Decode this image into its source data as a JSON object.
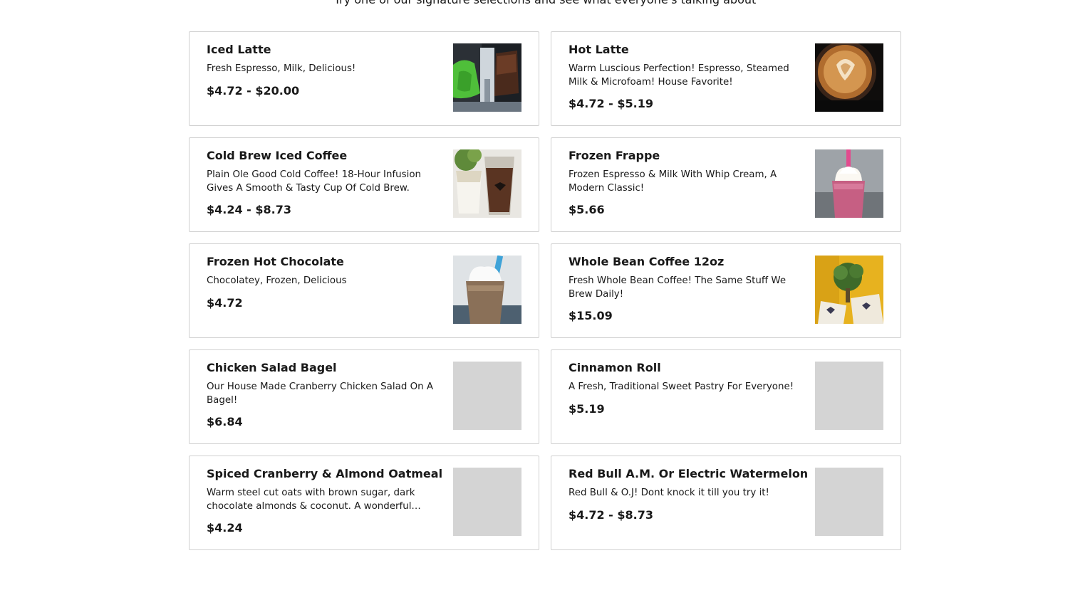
{
  "header": {
    "subtitle": "Try one of our signature selections and see what everyone's talking about"
  },
  "items": [
    {
      "name": "Iced Latte",
      "description": "Fresh Espresso, Milk, Delicious!",
      "price": "$4.72 - $20.00",
      "image": "iced-latte-photo"
    },
    {
      "name": "Hot Latte",
      "description": "Warm Luscious Perfection! Espresso, Steamed Milk & Microfoam! House Favorite!",
      "price": "$4.72 - $5.19",
      "image": "hot-latte-photo"
    },
    {
      "name": "Cold Brew Iced Coffee",
      "description": "Plain Ole Good Cold Coffee! 18-Hour Infusion Gives A Smooth & Tasty Cup Of Cold Brew.",
      "price": "$4.24 - $8.73",
      "image": "cold-brew-photo"
    },
    {
      "name": "Frozen Frappe",
      "description": "Frozen Espresso & Milk With Whip Cream, A Modern Classic!",
      "price": "$5.66",
      "image": "frozen-frappe-photo"
    },
    {
      "name": "Frozen Hot Chocolate",
      "description": "Chocolatey, Frozen, Delicious",
      "price": "$4.72",
      "image": "frozen-hot-chocolate-photo"
    },
    {
      "name": "Whole Bean Coffee 12oz",
      "description": "Fresh Whole Bean Coffee! The Same Stuff We Brew Daily!",
      "price": "$15.09",
      "image": "whole-bean-coffee-photo"
    },
    {
      "name": "Chicken Salad Bagel",
      "description": "Our House Made Cranberry Chicken Salad On A Bagel!",
      "price": "$6.84",
      "image": "placeholder"
    },
    {
      "name": "Cinnamon Roll",
      "description": "A Fresh, Traditional Sweet Pastry For Everyone!",
      "price": "$5.19",
      "image": "placeholder"
    },
    {
      "name": "Spiced Cranberry & Almond Oatmeal",
      "description": "Warm steel cut oats with brown sugar, dark chocolate almonds & coconut. A wonderful…",
      "price": "$4.24",
      "image": "placeholder"
    },
    {
      "name": "Red Bull A.M. Or Electric Watermelon",
      "description": "Red Bull & O.J! Dont knock it till you try it!",
      "price": "$4.72 - $8.73",
      "image": "placeholder"
    }
  ],
  "colors": {
    "text": "#191919",
    "card_border": "#d0d0d0",
    "placeholder": "#d4d4d4"
  }
}
